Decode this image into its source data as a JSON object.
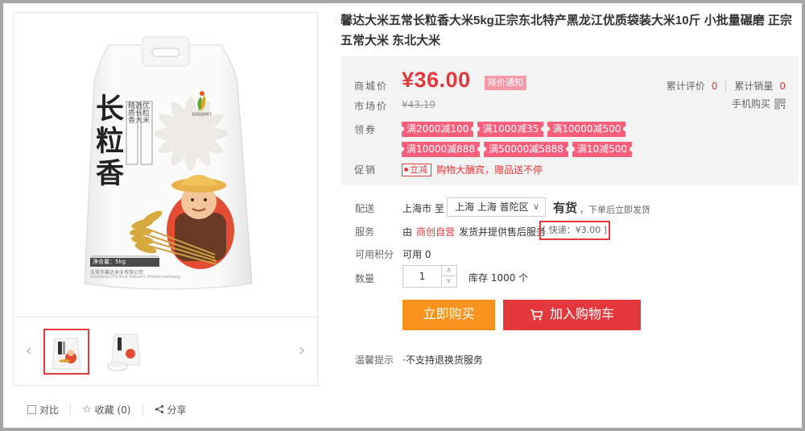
{
  "product": {
    "title": "馨达大米五常长粒香大米5kg正宗东北特产黑龙江优质袋装大米10斤 小批量碾磨 正宗五常大米 东北大米",
    "packaging": {
      "brand_text": "长粒香",
      "sub_text": "精选优质长粒香大米",
      "brand_mark": "XINWMY",
      "net_weight": "净含量：5kg",
      "producer": "五常市馨达米业有限公司",
      "producer_en": "Xinzhang City Rice Industry limited company",
      "colors": {
        "accent": "#e05a2a",
        "wheat": "#c9a246"
      }
    }
  },
  "price": {
    "label": "商城价",
    "value": "¥36.00",
    "notify": "降价通知",
    "market_label": "市场价",
    "market_value": "¥43.19",
    "review_label": "累计评价",
    "review_count": "0",
    "sales_label": "累计销量",
    "sales_count": "0",
    "mobile_buy": "手机购买",
    "coupon_label": "领券",
    "coupons": [
      "满2000减100",
      "满1000减35",
      "满10000减500",
      "满10000减888",
      "满50000减5888",
      "满10减500"
    ],
    "promo_label": "促销",
    "promo_tag": "立减",
    "promo_text": "购物大酬宾，赠品送不停"
  },
  "delivery": {
    "label": "配送",
    "from": "上海市 至",
    "region": "上海 上海 普陀区",
    "stock": "有货",
    "note": "，下单后立即发货"
  },
  "service": {
    "label": "服务",
    "prefix": "由",
    "shop": "商创自营",
    "suffix": "发货并提供售后服务",
    "fee": "[ 快递：¥3.00 ]"
  },
  "points": {
    "label": "可用积分",
    "value": "可用 0"
  },
  "quantity": {
    "label": "数量",
    "value": "1",
    "inventory": "库存 1000 个"
  },
  "buttons": {
    "buy": "立即购买",
    "cart": "加入购物车"
  },
  "tips": {
    "label": "温馨提示",
    "text": "·不支持退换货服务"
  },
  "actions": {
    "compare": "对比",
    "favorite": "收藏 (0)",
    "share": "分享"
  },
  "colors": {
    "price_red": "#e4393c",
    "buy_orange": "#f7931e",
    "coupon_pink": "#f95e7a"
  }
}
